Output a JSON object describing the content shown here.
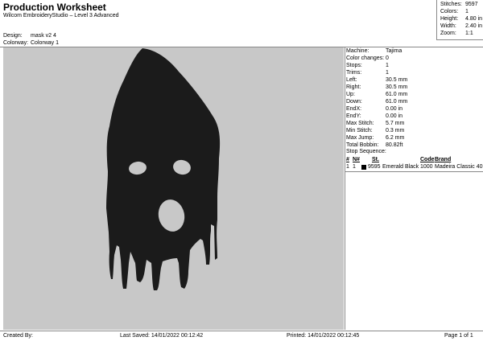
{
  "header": {
    "title": "Production Worksheet",
    "subtitle": "Wilcom EmbroideryStudio – Level 3 Advanced",
    "design_label": "Design:",
    "design_value": "mask v2 4",
    "colorway_label": "Colorway:",
    "colorway_value": "Colorway 1"
  },
  "summary": {
    "stitches_label": "Stitches:",
    "stitches_value": "9597",
    "colors_label": "Colors:",
    "colors_value": "1",
    "height_label": "Height:",
    "height_value": "4.80 in",
    "width_label": "Width:",
    "width_value": "2.40 in",
    "zoom_label": "Zoom:",
    "zoom_value": "1:1"
  },
  "design_info": [
    {
      "label": "Machine:",
      "value": "Tajima"
    },
    {
      "label": "Color changes:",
      "value": "0"
    },
    {
      "label": "Stops:",
      "value": "1"
    },
    {
      "label": "Trims:",
      "value": "1"
    },
    {
      "label": "Left:",
      "value": "30.5 mm"
    },
    {
      "label": "Right:",
      "value": "30.5 mm"
    },
    {
      "label": "Up:",
      "value": "61.0 mm"
    },
    {
      "label": "Down:",
      "value": "61.0 mm"
    },
    {
      "label": "EndX:",
      "value": "0.00 in"
    },
    {
      "label": "EndY:",
      "value": "0.00 in"
    },
    {
      "label": "Max Stitch:",
      "value": "5.7 mm"
    },
    {
      "label": "Min Stitch:",
      "value": "0.3 mm"
    },
    {
      "label": "Max Jump:",
      "value": "6.2 mm"
    },
    {
      "label": "Total Bobbin:",
      "value": "80.82ft"
    }
  ],
  "stop_sequence": {
    "title": "Stop Sequence:",
    "columns": [
      "#",
      "N#",
      "St.",
      "Code",
      "Brand"
    ],
    "rows": [
      {
        "num": "1",
        "needle": "1",
        "stitches": "9595",
        "color_name": "Emerald Black",
        "code": "1000",
        "brand": "Madeira Classic 40",
        "color": "#000000"
      }
    ]
  },
  "design_colors": {
    "canvas_bg": "#c8c8c8",
    "thread": "#1b1b1b",
    "holes": "#c8c8c8"
  },
  "footer": {
    "created_by": "Created By:",
    "last_saved": "Last Saved: 14/01/2022 00:12:42",
    "printed": "Printed: 14/01/2022 00:12:45",
    "page": "Page 1 of 1"
  }
}
